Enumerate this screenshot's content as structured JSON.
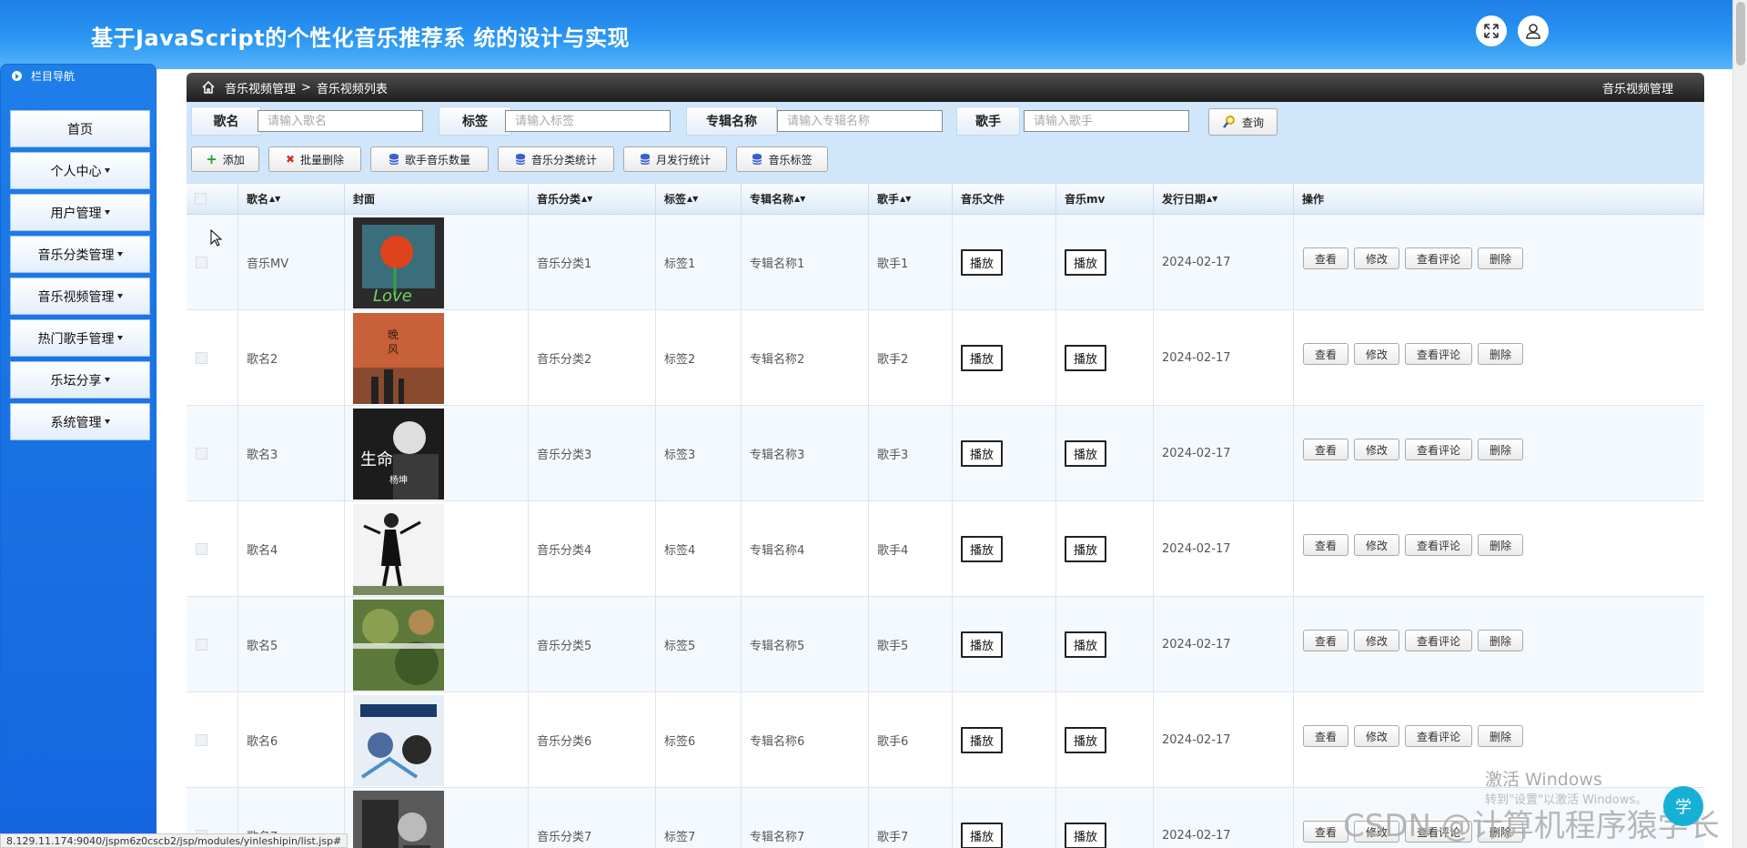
{
  "header": {
    "title": "基于JavaScript的个性化音乐推荐系 统的设计与实现"
  },
  "sidebar": {
    "title": "栏目导航",
    "items": [
      {
        "label": "首页",
        "dropdown": false
      },
      {
        "label": "个人中心",
        "dropdown": true
      },
      {
        "label": "用户管理",
        "dropdown": true
      },
      {
        "label": "音乐分类管理",
        "dropdown": true
      },
      {
        "label": "音乐视频管理",
        "dropdown": true
      },
      {
        "label": "热门歌手管理",
        "dropdown": true
      },
      {
        "label": "乐坛分享",
        "dropdown": true
      },
      {
        "label": "系统管理",
        "dropdown": true
      }
    ]
  },
  "breadcrumb": {
    "root": "音乐视频管理",
    "separator": ">",
    "current": "音乐视频列表",
    "right": "音乐视频管理"
  },
  "search": {
    "song_label": "歌名",
    "song_placeholder": "请输入歌名",
    "tag_label": "标签",
    "tag_placeholder": "请输入标签",
    "album_label": "专辑名称",
    "album_placeholder": "请输入专辑名称",
    "singer_label": "歌手",
    "singer_placeholder": "请输入歌手",
    "query_button": "查询"
  },
  "toolbar": {
    "add": "添加",
    "batch_delete": "批量删除",
    "singer_count": "歌手音乐数量",
    "category_stats": "音乐分类统计",
    "monthly_stats": "月发行统计",
    "music_tags": "音乐标签"
  },
  "table": {
    "columns": [
      "歌名",
      "封面",
      "音乐分类",
      "标签",
      "专辑名称",
      "歌手",
      "音乐文件",
      "音乐mv",
      "发行日期",
      "操作"
    ],
    "play_label": "播放",
    "actions": [
      "查看",
      "修改",
      "查看评论",
      "删除"
    ],
    "rows": [
      {
        "name": "音乐MV",
        "category": "音乐分类1",
        "tag": "标签1",
        "album": "专辑名称1",
        "singer": "歌手1",
        "date": "2024-02-17"
      },
      {
        "name": "歌名2",
        "category": "音乐分类2",
        "tag": "标签2",
        "album": "专辑名称2",
        "singer": "歌手2",
        "date": "2024-02-17"
      },
      {
        "name": "歌名3",
        "category": "音乐分类3",
        "tag": "标签3",
        "album": "专辑名称3",
        "singer": "歌手3",
        "date": "2024-02-17"
      },
      {
        "name": "歌名4",
        "category": "音乐分类4",
        "tag": "标签4",
        "album": "专辑名称4",
        "singer": "歌手4",
        "date": "2024-02-17"
      },
      {
        "name": "歌名5",
        "category": "音乐分类5",
        "tag": "标签5",
        "album": "专辑名称5",
        "singer": "歌手5",
        "date": "2024-02-17"
      },
      {
        "name": "歌名6",
        "category": "音乐分类6",
        "tag": "标签6",
        "album": "专辑名称6",
        "singer": "歌手6",
        "date": "2024-02-17"
      },
      {
        "name": "歌名7",
        "category": "音乐分类7",
        "tag": "标签7",
        "album": "专辑名称7",
        "singer": "歌手7",
        "date": "2024-02-17"
      }
    ]
  },
  "status_url": "8.129.11.174:9040/jspm6z0cscb2/jsp/modules/yinleshipin/list.jsp#",
  "watermark": {
    "windows": "激活 Windows",
    "windows_sub": "转到\"设置\"以激活 Windows。",
    "csdn": "CSDN @计算机程序猿学长"
  },
  "float_badge": "学",
  "colors": {
    "header_top": "#1e7ee8",
    "header_bottom": "#56b4fa",
    "sidebar": "#1466e0",
    "search_bg": "#cfe6fb",
    "breadcrumb": "#2b2b2b"
  }
}
